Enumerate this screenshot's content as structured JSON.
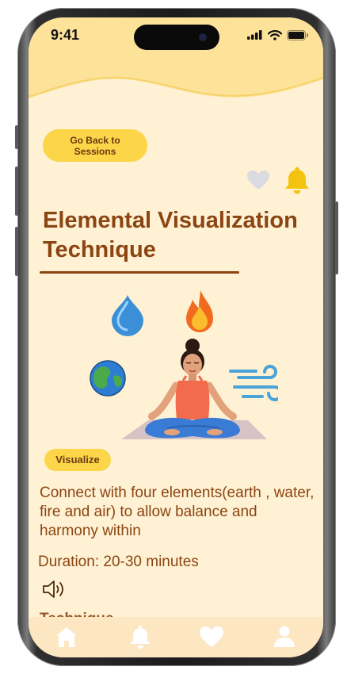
{
  "status_bar": {
    "time": "9:41"
  },
  "header": {
    "back_button_label": "Go Back to Sessions",
    "title": "Elemental Visualization Technique"
  },
  "actions": {
    "favorite_icon": "heart-icon",
    "reminder_icon": "bell-icon"
  },
  "content": {
    "tag": "Visualize",
    "description": "Connect with four elements(earth , water, fire and air) to allow balance and harmony within",
    "duration": "Duration: 20-30 minutes",
    "audio_icon": "speaker-icon",
    "next_heading_peek": "Technique"
  },
  "tab_bar": {
    "items": [
      {
        "icon": "home-icon"
      },
      {
        "icon": "bell-icon"
      },
      {
        "icon": "heart-icon"
      },
      {
        "icon": "profile-icon"
      }
    ]
  },
  "colors": {
    "background": "#fff1d4",
    "accent": "#fcd548",
    "text": "#8b4513",
    "tab_bar": "#fde6c2"
  }
}
